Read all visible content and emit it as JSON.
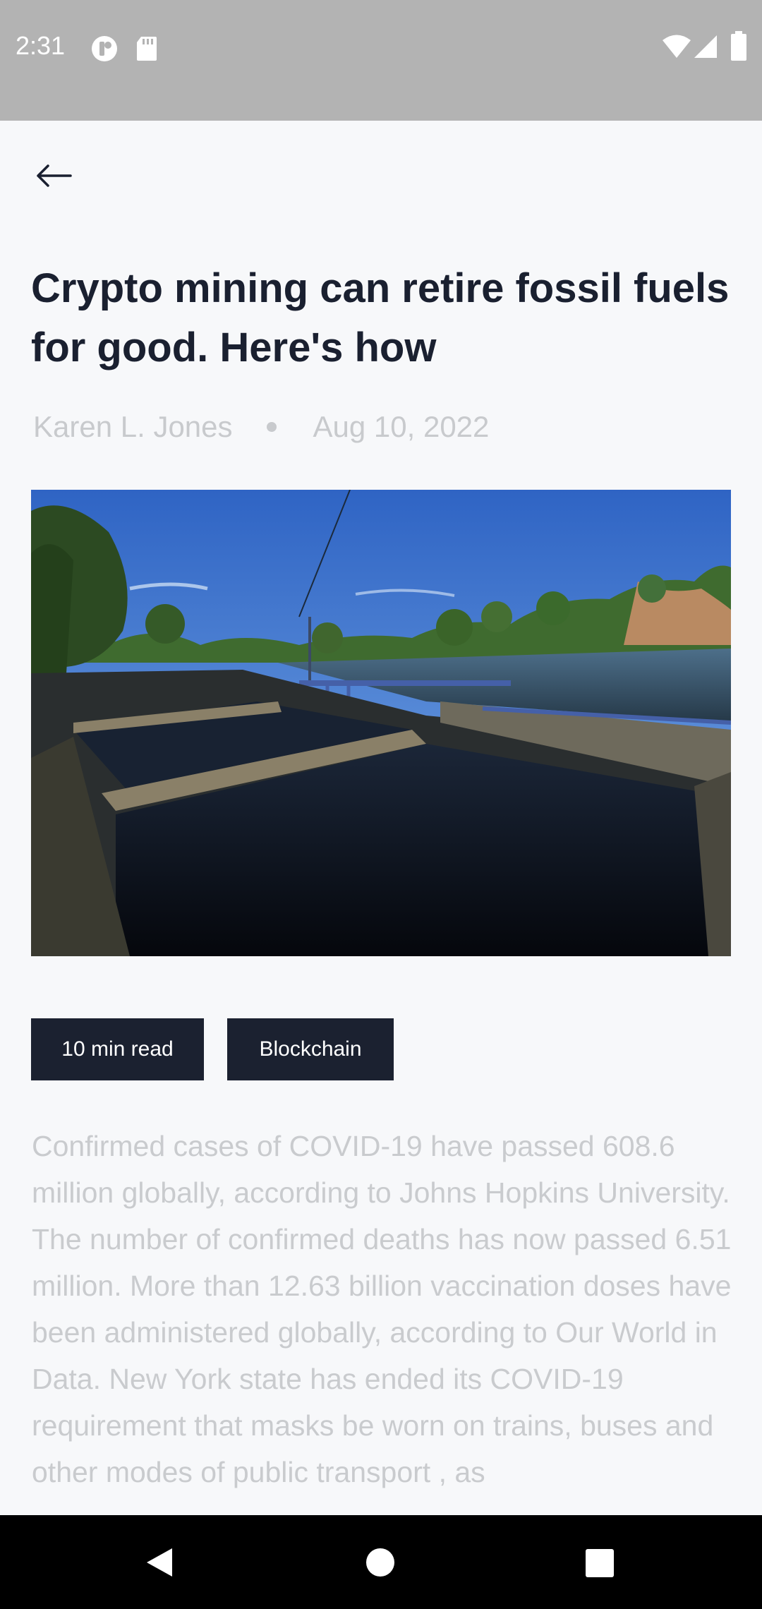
{
  "status_bar": {
    "time": "2:31",
    "left_icons": [
      "notification-app-icon",
      "sd-card-icon"
    ],
    "right_icons": [
      "wifi-icon",
      "cell-signal-icon",
      "battery-icon"
    ]
  },
  "toolbar": {
    "back_icon": "arrow-left-icon"
  },
  "article": {
    "title": "Crypto mining can retire fossil fuels for good. Here's how",
    "author": "Karen L. Jones",
    "date": "Aug 10, 2022",
    "read_time": "10 min read",
    "category": "Blockchain",
    "body": "Confirmed cases of COVID-19 have passed 608.6 million globally, according to Johns Hopkins University. The number of confirmed deaths has now passed 6.51 million. More than 12.63 billion vaccination doses have been administered globally, according to Our World in Data. New York state has ended its COVID-19 requirement that masks be worn on trains, buses and other modes of public transport , as"
  },
  "nav_bar": {
    "icons": [
      "back-triangle-icon",
      "home-circle-icon",
      "recents-square-icon"
    ]
  },
  "colors": {
    "status_bar": "#b3b3b3",
    "background": "#f7f8fa",
    "title_text": "#1a2030",
    "muted_text": "#c8cacd",
    "tag_background": "#1b2130",
    "nav_bar": "#000000"
  }
}
